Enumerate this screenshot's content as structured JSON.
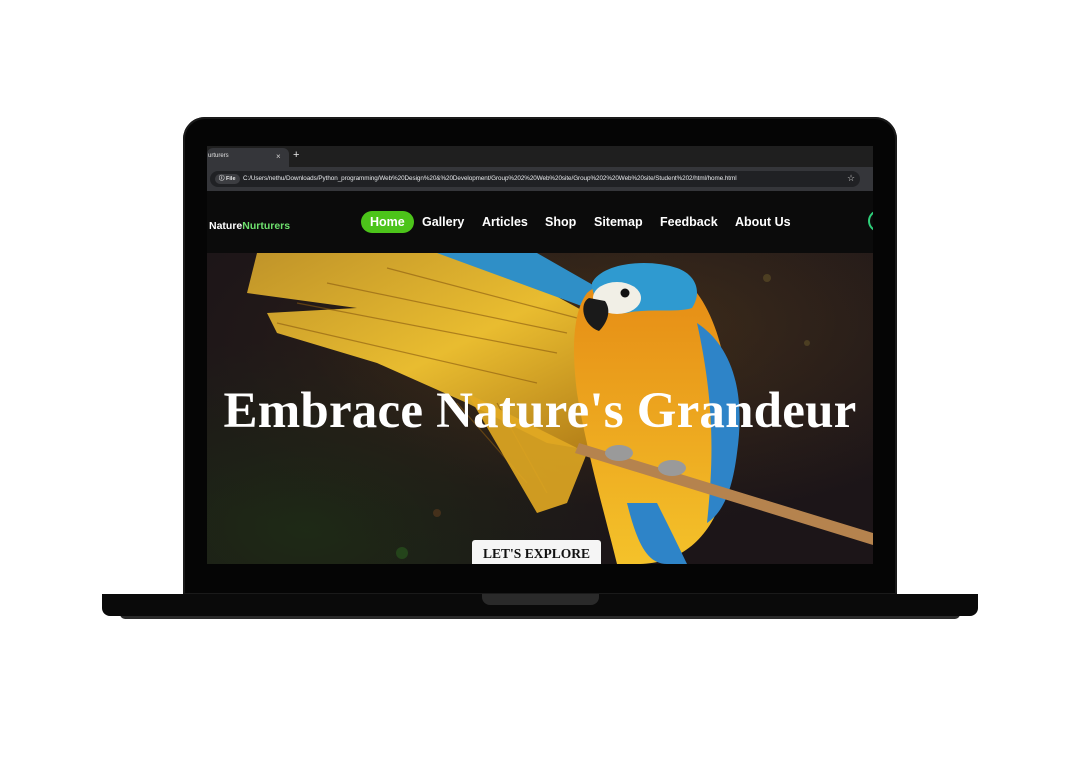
{
  "browser": {
    "tab_title": "urturers",
    "tab_close": "×",
    "new_tab": "+",
    "info_chip": "ⓘ File",
    "url": "C:/Users/nethu/Downloads/Python_programming/Web%20Design%20&%20Development/Group%202%20Web%20site/Group%202%20Web%20site/Student%202/html/home.html",
    "star": "☆"
  },
  "site": {
    "logo_primary": "Nature",
    "logo_accent": "Nurturers",
    "nav": [
      "Home",
      "Gallery",
      "Articles",
      "Shop",
      "Sitemap",
      "Feedback",
      "About Us"
    ],
    "active_nav": "Home",
    "hero_title": "Embrace Nature's Grandeur",
    "cta_label": "LET'S EXPLORE"
  },
  "colors": {
    "accent_green": "#4cc41a",
    "logo_green": "#6ee06e",
    "circle_green": "#2ed07a"
  }
}
